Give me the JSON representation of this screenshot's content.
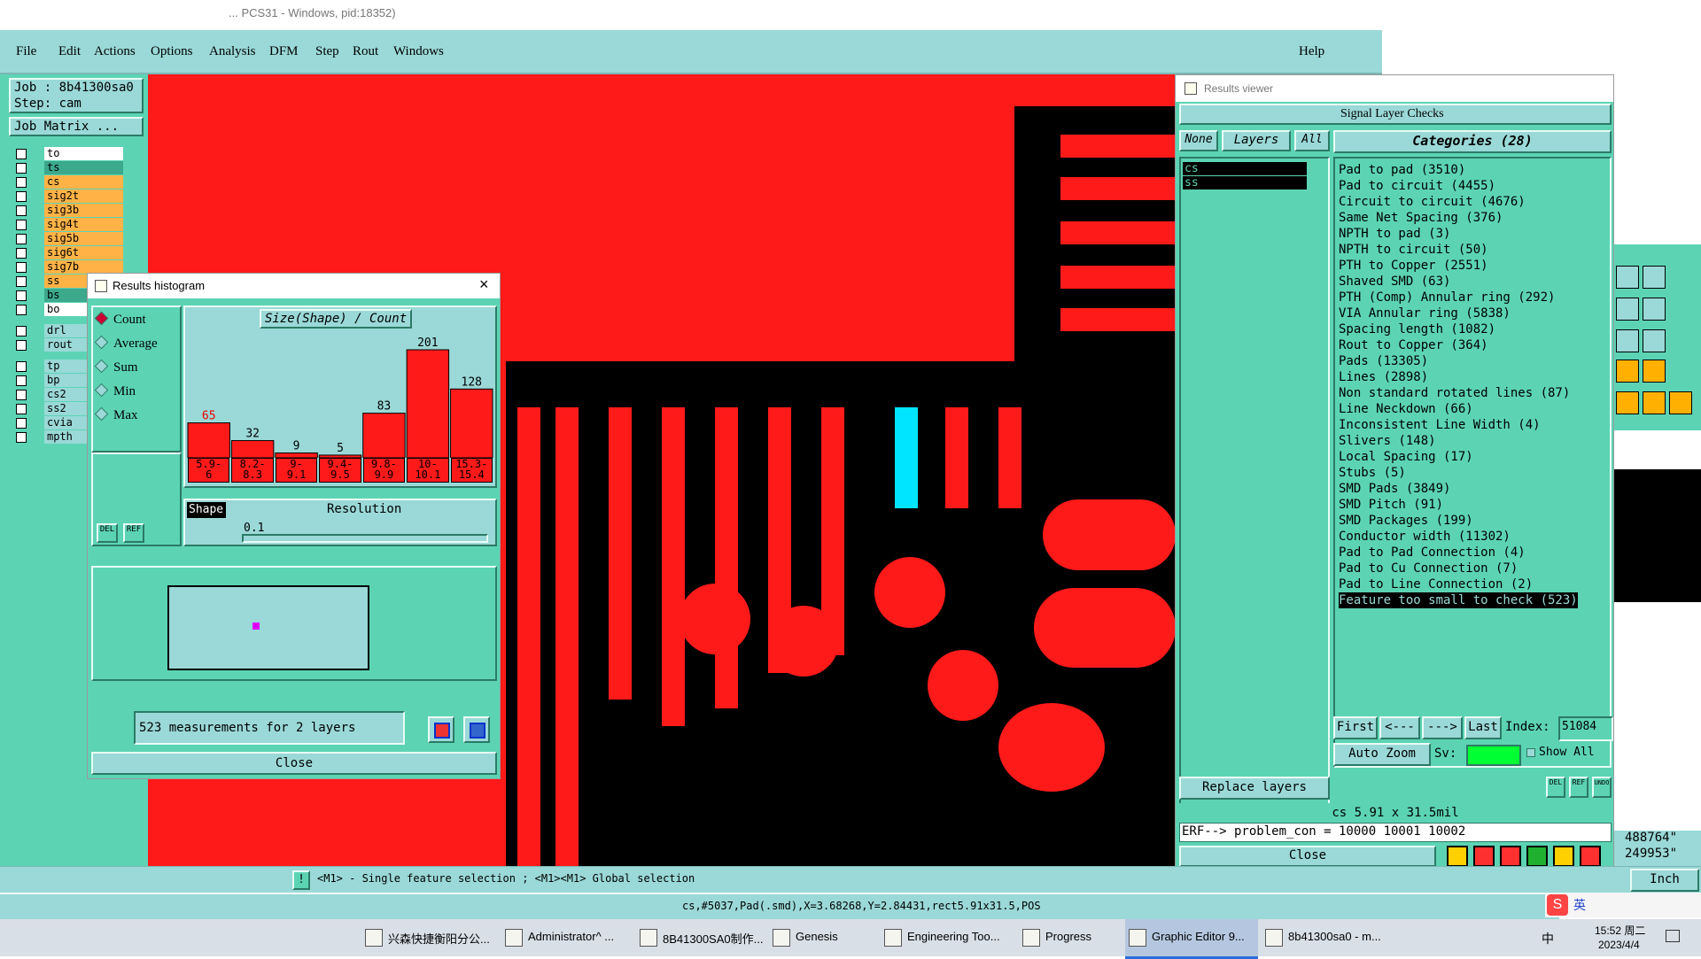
{
  "window_title": "... PCS31 - Windows, pid:18352)",
  "menu": [
    "File",
    "Edit",
    "Actions",
    "Options",
    "Analysis",
    "DFM",
    "Step",
    "Rout",
    "Windows"
  ],
  "menu_help": "Help",
  "job": {
    "job_label": "Job : 8b41300sa0",
    "step_label": "Step: cam",
    "matrix_button": "Job Matrix ..."
  },
  "layers": [
    {
      "name": "to",
      "color": "#ffffff"
    },
    {
      "name": "ts",
      "color": "#3ca88c"
    },
    {
      "name": "cs",
      "color": "#ffb347"
    },
    {
      "name": "sig2t",
      "color": "#ffb347"
    },
    {
      "name": "sig3b",
      "color": "#ffb347"
    },
    {
      "name": "sig4t",
      "color": "#ffb347"
    },
    {
      "name": "sig5b",
      "color": "#ffb347"
    },
    {
      "name": "sig6t",
      "color": "#ffb347"
    },
    {
      "name": "sig7b",
      "color": "#ffb347"
    },
    {
      "name": "ss",
      "color": "#ffb347"
    },
    {
      "name": "bs",
      "color": "#3ca88c"
    },
    {
      "name": "bo",
      "color": "#ffffff"
    }
  ],
  "layers2": [
    "drl",
    "rout"
  ],
  "layers3": [
    "tp",
    "bp",
    "cs2",
    "ss2",
    "cvia",
    "mpth"
  ],
  "histogram": {
    "title": "Results histogram",
    "options": [
      "Count",
      "Average",
      "Sum",
      "Min",
      "Max"
    ],
    "selected": "Count",
    "chart_title": "Size(Shape) / Count",
    "bins": [
      "5.9-6",
      "8.2-8.3",
      "9-9.1",
      "9.4-9.5",
      "9.8-9.9",
      "10-10.1",
      "15.3-15.4"
    ],
    "bin_top": [
      "5.9-",
      "8.2-",
      "9-",
      "9.4-",
      "9.8-",
      "10-",
      "15.3-"
    ],
    "bin_bottom": [
      "6",
      "8.3",
      "9.1",
      "9.5",
      "9.9",
      "10.1",
      "15.4"
    ],
    "counts": [
      "65",
      "32",
      "9",
      "5",
      "83",
      "201",
      "128"
    ],
    "count_values": [
      65,
      32,
      9,
      5,
      83,
      201,
      128
    ],
    "shape_label": "Shape",
    "resolution_label": "Resolution",
    "resolution_value": "0.1",
    "del": "DEL",
    "ref": "REF",
    "measurements": "523 measurements for 2 layers",
    "close": "Close"
  },
  "results": {
    "title": "Results viewer",
    "heading": "Signal Layer Checks",
    "none": "None",
    "layers": "Layers",
    "all": "All",
    "categories_header": "Categories (28)",
    "layer_list": [
      "cs",
      "ss"
    ],
    "categories": [
      "Pad to pad (3510)",
      "Pad to circuit (4455)",
      "Circuit to circuit (4676)",
      "Same Net Spacing (376)",
      "NPTH to pad (3)",
      "NPTH to circuit (50)",
      "PTH to Copper (2551)",
      "Shaved SMD (63)",
      "PTH (Comp) Annular ring (292)",
      "VIA Annular ring (5838)",
      "Spacing length (1082)",
      "Rout to Copper (364)",
      "Pads (13305)",
      "Lines (2898)",
      "Non standard rotated lines (87)",
      "Line Neckdown (66)",
      "Inconsistent Line Width (4)",
      "Slivers (148)",
      "Local Spacing (17)",
      "Stubs (5)",
      "SMD Pads (3849)",
      "SMD Pitch (91)",
      "SMD Packages (199)",
      "Conductor width (11302)",
      "Pad to Pad Connection (4)",
      "Pad to Cu Connection (7)",
      "Pad to Line Connection (2)",
      "Feature too small to check (523)"
    ],
    "selected_category": "Feature too small to check (523)",
    "nav": {
      "first": "First",
      "prev": "<---",
      "next": "--->",
      "last": "Last",
      "index_label": "Index:",
      "index_value": "51084"
    },
    "auto_zoom": "Auto Zoom",
    "sv_label": "Sv:",
    "show_all": "Show All",
    "replace_layers": "Replace layers",
    "del": "DEL",
    "ref": "REF",
    "undo": "UNDO",
    "feature_info": "cs 5.91 x 31.5mil",
    "erf": "ERF--> problem_con = 10000 10001 10002",
    "close": "Close"
  },
  "coords_right": [
    "488764\"",
    "249953\""
  ],
  "units": "Inch",
  "status_hint": "<M1> - Single feature selection ; <M1><M1> Global selection",
  "status_feature": "cs,#5037,Pad(.smd),X=3.68268,Y=2.84431,rect5.91x31.5,POS",
  "taskbar": {
    "items": [
      {
        "label": "兴森快捷衡阳分公...",
        "icon": "chat-icon"
      },
      {
        "label": "Administrator^ ...",
        "icon": "floppy-icon"
      },
      {
        "label": "8B41300SA0制作...",
        "icon": "excel-icon"
      },
      {
        "label": "Genesis",
        "icon": "genesis-icon"
      },
      {
        "label": "Engineering Too...",
        "icon": "app-icon"
      },
      {
        "label": "Progress",
        "icon": "app-icon"
      },
      {
        "label": "Graphic Editor 9...",
        "icon": "app-icon"
      },
      {
        "label": "8b41300sa0 - m...",
        "icon": "app-icon"
      }
    ],
    "active_index": 6,
    "ime": "中",
    "ime_lang": "英",
    "time": "15:52 周二",
    "date": "2023/4/4"
  },
  "colors": {
    "teal": "#5cd4b4",
    "light_teal": "#9ad9d7",
    "red": "#ff1a1a",
    "cyan": "#00e5ff",
    "black": "#000000"
  }
}
